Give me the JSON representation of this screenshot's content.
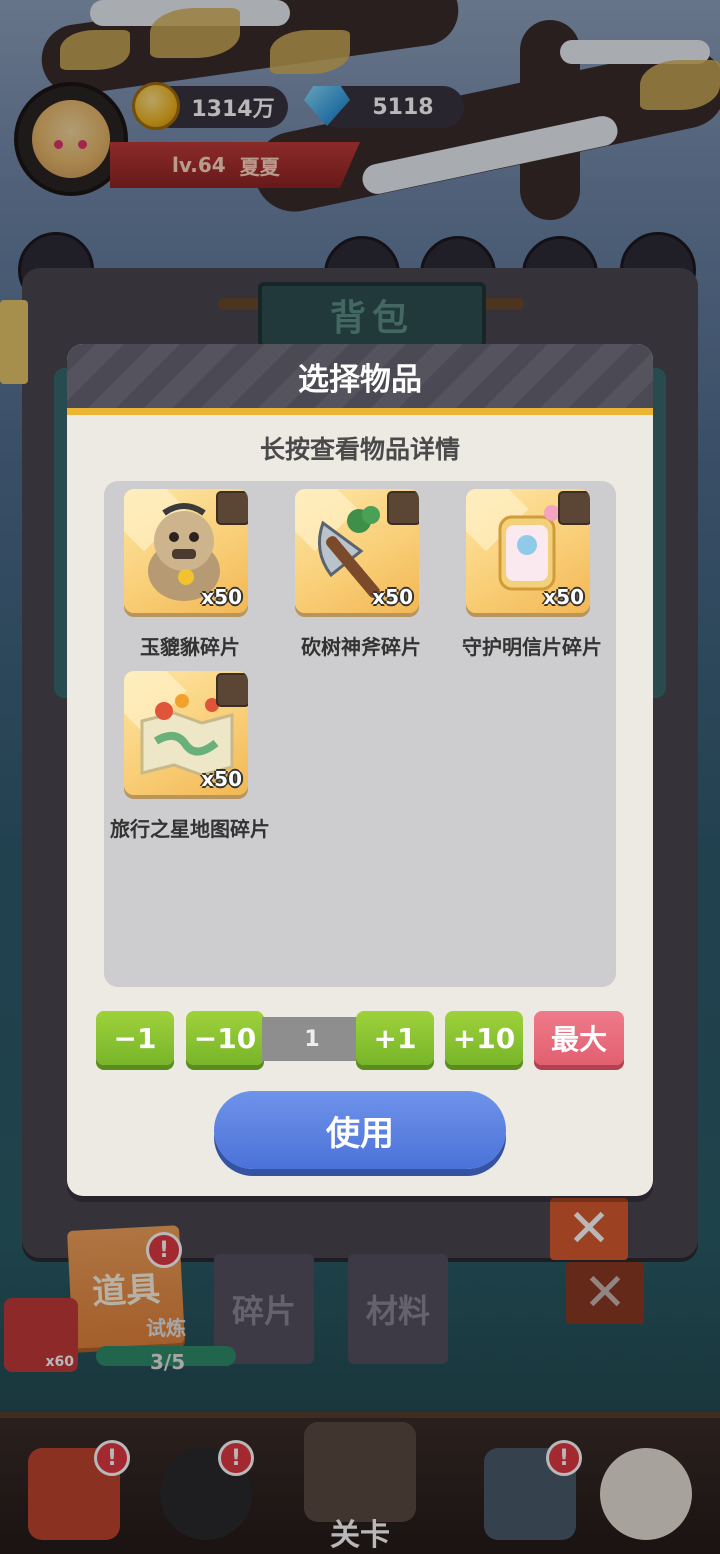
{
  "hud": {
    "coins": "1314万",
    "gems": "5118",
    "level": "lv.64",
    "player_name": "夏夏"
  },
  "backpack": {
    "title": "背包",
    "tabs": [
      {
        "label": "道具",
        "badge": "!"
      },
      {
        "label": "碎片"
      },
      {
        "label": "材料"
      }
    ],
    "side_item_qty": "x60",
    "task_progress": "3/5",
    "task_fragment": "试炼"
  },
  "dialog": {
    "title": "选择物品",
    "hint": "长按查看物品详情",
    "items": [
      {
        "name": "玉貔貅碎片",
        "qty": "x50",
        "icon": "pixiu-icon"
      },
      {
        "name": "砍树神斧碎片",
        "qty": "x50",
        "icon": "axe-icon"
      },
      {
        "name": "守护明信片碎片",
        "qty": "x50",
        "icon": "postcard-icon"
      },
      {
        "name": "旅行之星地图碎片",
        "qty": "x50",
        "icon": "map-icon"
      }
    ],
    "stepper": {
      "minus1": "−1",
      "minus10": "−10",
      "value": "1",
      "plus1": "+1",
      "plus10": "+10",
      "max": "最大"
    },
    "use_button": "使用"
  },
  "bottom_nav": {
    "center_label": "关卡",
    "badge": "!"
  },
  "colors": {
    "green_button": "#8cc63f",
    "max_button": "#e8697a",
    "use_button": "#5a80e0",
    "dialog_stripe": "#e9b532"
  }
}
